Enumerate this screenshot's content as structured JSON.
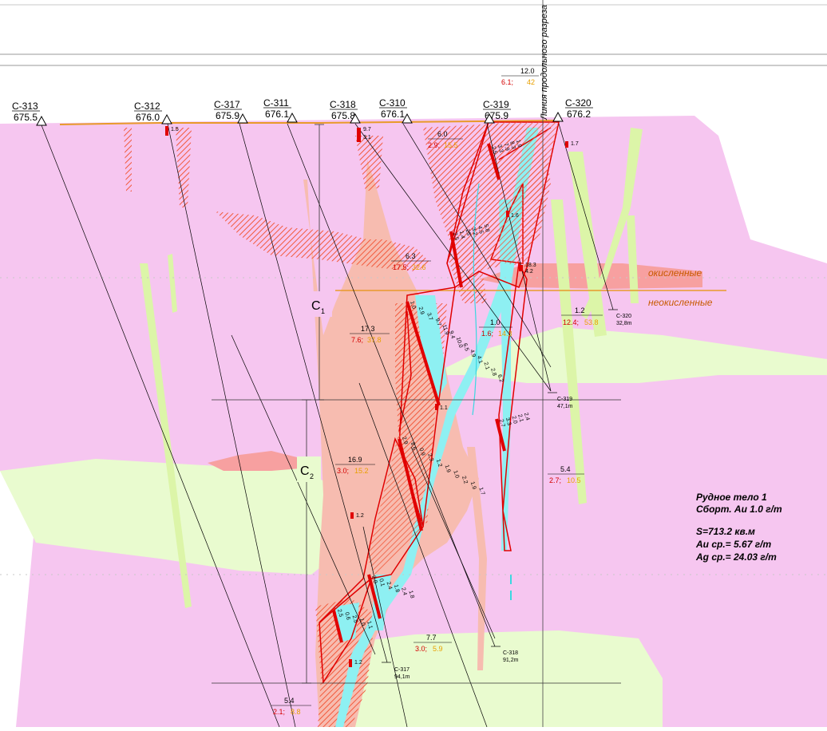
{
  "boreholes": [
    {
      "name": "С-313",
      "elev": "675.5"
    },
    {
      "name": "С-312",
      "elev": "676.0"
    },
    {
      "name": "С-317",
      "elev": "675.9"
    },
    {
      "name": "С-311",
      "elev": "676.1"
    },
    {
      "name": "С-318",
      "elev": "675.8"
    },
    {
      "name": "С-310",
      "elev": "676.1"
    },
    {
      "name": "С-319",
      "elev": "675.9"
    },
    {
      "name": "С-320",
      "elev": "676.2"
    }
  ],
  "bottom_labels": [
    {
      "name": "С-320",
      "depth": "32,8m"
    },
    {
      "name": "С-319",
      "depth": "47,1m"
    },
    {
      "name": "С-318",
      "depth": "91,2m"
    },
    {
      "name": "С-317",
      "depth": "94,1m"
    }
  ],
  "intervals": [
    {
      "thick": "12.0",
      "au": "6.1;",
      "ag": "42"
    },
    {
      "thick": "6.0",
      "au": "2.9;",
      "ag": "15.5"
    },
    {
      "thick": "6.3",
      "au": "17.5;",
      "ag": "32.6"
    },
    {
      "thick": "17.3",
      "au": "7.6;",
      "ag": "37.8"
    },
    {
      "thick": "1.0",
      "au": "1.6;",
      "ag": "14.3"
    },
    {
      "thick": "1.2",
      "au": "12.4;",
      "ag": "53.8"
    },
    {
      "thick": "16.9",
      "au": "3.0;",
      "ag": "15.2"
    },
    {
      "thick": "5.4",
      "au": "2.7;",
      "ag": "10.5"
    },
    {
      "thick": "7.7",
      "au": "3.0;",
      "ag": "5.9"
    },
    {
      "thick": "5.4",
      "au": "2.1;",
      "ag": "8.8"
    }
  ],
  "single_values": [
    "1.5",
    "9.7",
    "3.1",
    "1.7",
    "1.6",
    "18.3",
    "4.2",
    "1.1",
    "1.2",
    "1.2"
  ],
  "column_values": {
    "c319_top": [
      "2.5",
      "3.3",
      "7.9",
      "8.3",
      "1.9"
    ],
    "c310_mid": [
      "2.5",
      "1.4",
      "25",
      "3.2",
      "4.5",
      "5.8"
    ],
    "c318_upper": [
      "1.0",
      "2.9",
      "3.7",
      "9.7",
      "11.9",
      "9.4",
      "10.0",
      "6.5",
      "4.9",
      "4.1",
      "2.1",
      "2.8",
      "6.2"
    ],
    "c319_lower": [
      "2.7",
      "3.3",
      "2.0",
      "2.1",
      "2.4"
    ],
    "c318_lower": [
      "2.9",
      "8.6",
      "0.9",
      "2.3",
      "1.2",
      "1.9",
      "1.0",
      "2.2",
      "1.9",
      "1.7"
    ],
    "c317_a": [
      "2.0",
      "0.1",
      "2.4",
      "1.8",
      "2.4",
      "1.8"
    ],
    "c317_b": [
      "2.5",
      "0.6",
      "2.5",
      "1.0",
      "1.1"
    ]
  },
  "zone_labels": {
    "oxidized": "окисленные",
    "unoxidized": "неокисленные"
  },
  "block_labels": {
    "c1": "С",
    "c1_sub": "1",
    "c2": "С",
    "c2_sub": "2"
  },
  "profile_line_label": "Линия продольного разреза",
  "summary": {
    "line1": "Рудное тело 1",
    "line2": "Сборт. Au 1.0 г/т",
    "line3": "S=713.2 кв.м",
    "line4": "Au ср.= 5.67 г/т",
    "line5": "Ag ср.= 24.03 г/т"
  },
  "colors": {
    "country_rock": "#f6c6f0",
    "green_unit": "#e9fbcf",
    "dyke": "#dcf5a8",
    "salmon": "#f7bcb0",
    "ore_hatch": "#f25a3c",
    "ore_outline": "#e00000",
    "cyan_vein": "#8ef0f2",
    "surface": "#e89a2a",
    "grade_red": "#d40000",
    "grade_orange": "#e8a000"
  }
}
